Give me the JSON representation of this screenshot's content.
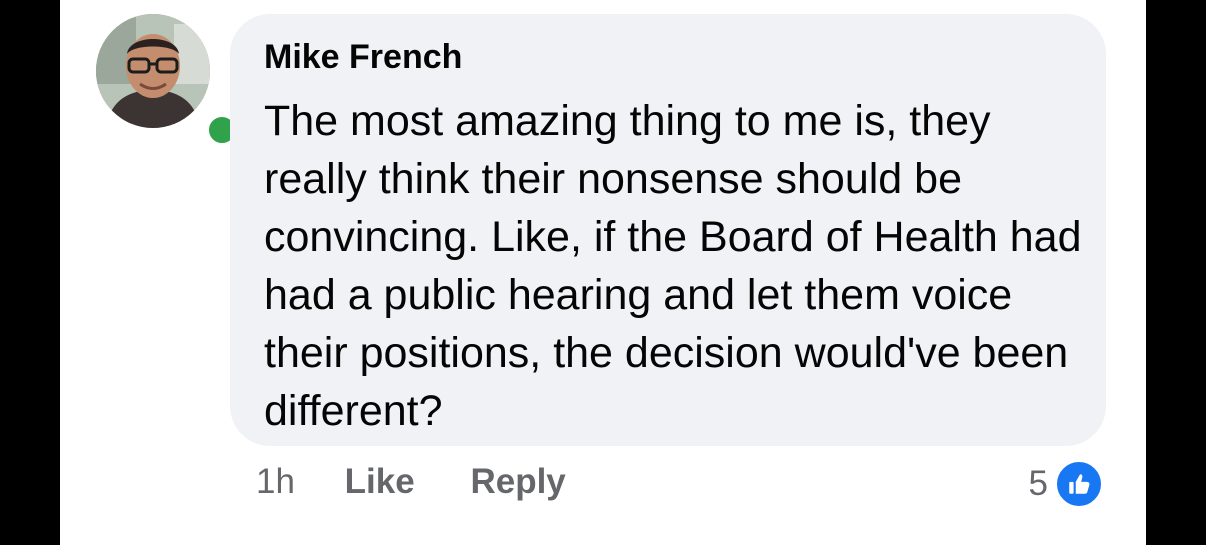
{
  "comment": {
    "author_name": "Mike French",
    "text": "The most amazing thing to me is, they really think their nonsense should be convincing. Like, if the Board of Health had had a public hearing and let them voice their positions, the decision would've been different?",
    "avatar_icon": "profile-photo",
    "online_status": "active",
    "online_color": "#31a24c"
  },
  "actions": {
    "timestamp": "1h",
    "like_label": "Like",
    "reply_label": "Reply"
  },
  "reactions": {
    "count": "5",
    "icon": "thumbs-up-icon",
    "color": "#1877f2"
  },
  "colors": {
    "bubble_background": "#f0f2f5",
    "secondary_text": "#65676b",
    "primary_text": "#050505"
  }
}
